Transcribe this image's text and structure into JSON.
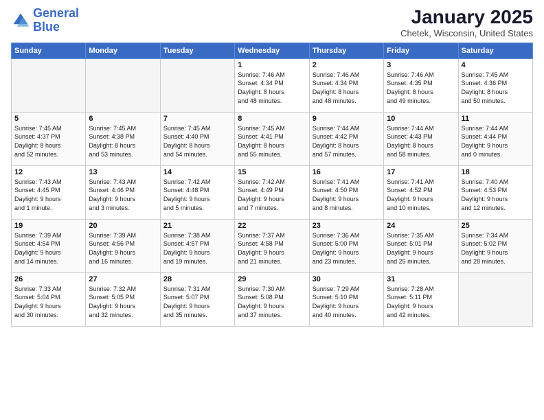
{
  "logo": {
    "line1": "General",
    "line2": "Blue"
  },
  "title": "January 2025",
  "subtitle": "Chetek, Wisconsin, United States",
  "weekdays": [
    "Sunday",
    "Monday",
    "Tuesday",
    "Wednesday",
    "Thursday",
    "Friday",
    "Saturday"
  ],
  "weeks": [
    [
      {
        "day": "",
        "info": ""
      },
      {
        "day": "",
        "info": ""
      },
      {
        "day": "",
        "info": ""
      },
      {
        "day": "1",
        "info": "Sunrise: 7:46 AM\nSunset: 4:34 PM\nDaylight: 8 hours\nand 48 minutes."
      },
      {
        "day": "2",
        "info": "Sunrise: 7:46 AM\nSunset: 4:34 PM\nDaylight: 8 hours\nand 48 minutes."
      },
      {
        "day": "3",
        "info": "Sunrise: 7:46 AM\nSunset: 4:35 PM\nDaylight: 8 hours\nand 49 minutes."
      },
      {
        "day": "4",
        "info": "Sunrise: 7:45 AM\nSunset: 4:36 PM\nDaylight: 8 hours\nand 50 minutes."
      }
    ],
    [
      {
        "day": "5",
        "info": "Sunrise: 7:45 AM\nSunset: 4:37 PM\nDaylight: 8 hours\nand 52 minutes."
      },
      {
        "day": "6",
        "info": "Sunrise: 7:45 AM\nSunset: 4:38 PM\nDaylight: 8 hours\nand 53 minutes."
      },
      {
        "day": "7",
        "info": "Sunrise: 7:45 AM\nSunset: 4:40 PM\nDaylight: 8 hours\nand 54 minutes."
      },
      {
        "day": "8",
        "info": "Sunrise: 7:45 AM\nSunset: 4:41 PM\nDaylight: 8 hours\nand 55 minutes."
      },
      {
        "day": "9",
        "info": "Sunrise: 7:44 AM\nSunset: 4:42 PM\nDaylight: 8 hours\nand 57 minutes."
      },
      {
        "day": "10",
        "info": "Sunrise: 7:44 AM\nSunset: 4:43 PM\nDaylight: 8 hours\nand 58 minutes."
      },
      {
        "day": "11",
        "info": "Sunrise: 7:44 AM\nSunset: 4:44 PM\nDaylight: 9 hours\nand 0 minutes."
      }
    ],
    [
      {
        "day": "12",
        "info": "Sunrise: 7:43 AM\nSunset: 4:45 PM\nDaylight: 9 hours\nand 1 minute."
      },
      {
        "day": "13",
        "info": "Sunrise: 7:43 AM\nSunset: 4:46 PM\nDaylight: 9 hours\nand 3 minutes."
      },
      {
        "day": "14",
        "info": "Sunrise: 7:42 AM\nSunset: 4:48 PM\nDaylight: 9 hours\nand 5 minutes."
      },
      {
        "day": "15",
        "info": "Sunrise: 7:42 AM\nSunset: 4:49 PM\nDaylight: 9 hours\nand 7 minutes."
      },
      {
        "day": "16",
        "info": "Sunrise: 7:41 AM\nSunset: 4:50 PM\nDaylight: 9 hours\nand 8 minutes."
      },
      {
        "day": "17",
        "info": "Sunrise: 7:41 AM\nSunset: 4:52 PM\nDaylight: 9 hours\nand 10 minutes."
      },
      {
        "day": "18",
        "info": "Sunrise: 7:40 AM\nSunset: 4:53 PM\nDaylight: 9 hours\nand 12 minutes."
      }
    ],
    [
      {
        "day": "19",
        "info": "Sunrise: 7:39 AM\nSunset: 4:54 PM\nDaylight: 9 hours\nand 14 minutes."
      },
      {
        "day": "20",
        "info": "Sunrise: 7:39 AM\nSunset: 4:56 PM\nDaylight: 9 hours\nand 16 minutes."
      },
      {
        "day": "21",
        "info": "Sunrise: 7:38 AM\nSunset: 4:57 PM\nDaylight: 9 hours\nand 19 minutes."
      },
      {
        "day": "22",
        "info": "Sunrise: 7:37 AM\nSunset: 4:58 PM\nDaylight: 9 hours\nand 21 minutes."
      },
      {
        "day": "23",
        "info": "Sunrise: 7:36 AM\nSunset: 5:00 PM\nDaylight: 9 hours\nand 23 minutes."
      },
      {
        "day": "24",
        "info": "Sunrise: 7:35 AM\nSunset: 5:01 PM\nDaylight: 9 hours\nand 25 minutes."
      },
      {
        "day": "25",
        "info": "Sunrise: 7:34 AM\nSunset: 5:02 PM\nDaylight: 9 hours\nand 28 minutes."
      }
    ],
    [
      {
        "day": "26",
        "info": "Sunrise: 7:33 AM\nSunset: 5:04 PM\nDaylight: 9 hours\nand 30 minutes."
      },
      {
        "day": "27",
        "info": "Sunrise: 7:32 AM\nSunset: 5:05 PM\nDaylight: 9 hours\nand 32 minutes."
      },
      {
        "day": "28",
        "info": "Sunrise: 7:31 AM\nSunset: 5:07 PM\nDaylight: 9 hours\nand 35 minutes."
      },
      {
        "day": "29",
        "info": "Sunrise: 7:30 AM\nSunset: 5:08 PM\nDaylight: 9 hours\nand 37 minutes."
      },
      {
        "day": "30",
        "info": "Sunrise: 7:29 AM\nSunset: 5:10 PM\nDaylight: 9 hours\nand 40 minutes."
      },
      {
        "day": "31",
        "info": "Sunrise: 7:28 AM\nSunset: 5:11 PM\nDaylight: 9 hours\nand 42 minutes."
      },
      {
        "day": "",
        "info": ""
      }
    ]
  ]
}
